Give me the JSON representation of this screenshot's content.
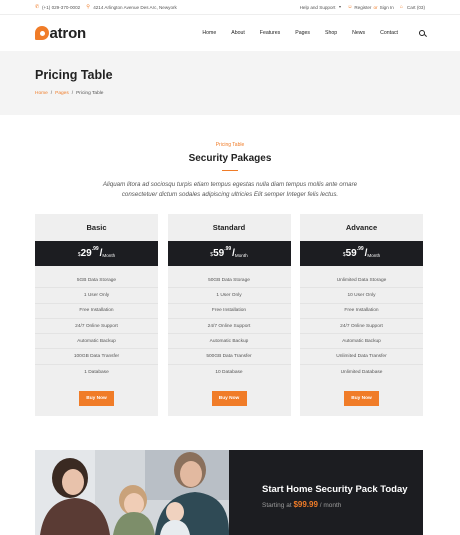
{
  "topbar": {
    "phone": "(+1) 029-370-0002",
    "address": "4214 Arlington Avenue Des Arc, Newyork",
    "help": "Help and Support",
    "register": "Register",
    "or": "or",
    "signin": "Sign In",
    "cart": "Cart (03)"
  },
  "brand": {
    "logo_text": "atron"
  },
  "nav": {
    "items": [
      "Home",
      "About",
      "Features",
      "Pages",
      "Shop",
      "News",
      "Contact"
    ]
  },
  "page": {
    "title": "Pricing Table",
    "breadcrumb": [
      "Home",
      "Pages",
      "Pricing Table"
    ]
  },
  "section": {
    "kicker": "Pricing Table",
    "title": "Security Pakages",
    "desc": "Aliquam litora ad sociosqu turpis etiam tempus egestas nulla diam tempus mollis ante ornare consectetuer dictum sodales adipiscing ultricies Elit semper Integer felis lectus."
  },
  "plans": [
    {
      "name": "Basic",
      "currency": "$",
      "amount": "29",
      "cents": ".99",
      "per": "Month",
      "features": [
        "5GB Data Storage",
        "1 User Only",
        "Free Installation",
        "24/7 Online Support",
        "Automatic Backup",
        "100GB Data Transfer",
        "1 Database"
      ],
      "button": "Buy Now"
    },
    {
      "name": "Standard",
      "currency": "$",
      "amount": "59",
      "cents": ".99",
      "per": "Month",
      "features": [
        "50GB Data Storage",
        "1 User Only",
        "Free Installation",
        "24/7 Online Support",
        "Automatic Backup",
        "500GB Data Transfer",
        "10 Database"
      ],
      "button": "Buy Now"
    },
    {
      "name": "Advance",
      "currency": "$",
      "amount": "59",
      "cents": ".99",
      "per": "Month",
      "features": [
        "Unlimited Data Storage",
        "10 User Only",
        "Free Installation",
        "24/7 Online Support",
        "Automatic Backup",
        "Unlimited Data Transfer",
        "Unlimited Database"
      ],
      "button": "Buy Now"
    }
  ],
  "promo": {
    "title": "Start Home Security Pack Today",
    "starting": "Starting at",
    "price": "$99.99",
    "per": "/ month"
  },
  "colors": {
    "accent": "#f07c28",
    "dark": "#1c1d21",
    "card": "#efefef"
  }
}
